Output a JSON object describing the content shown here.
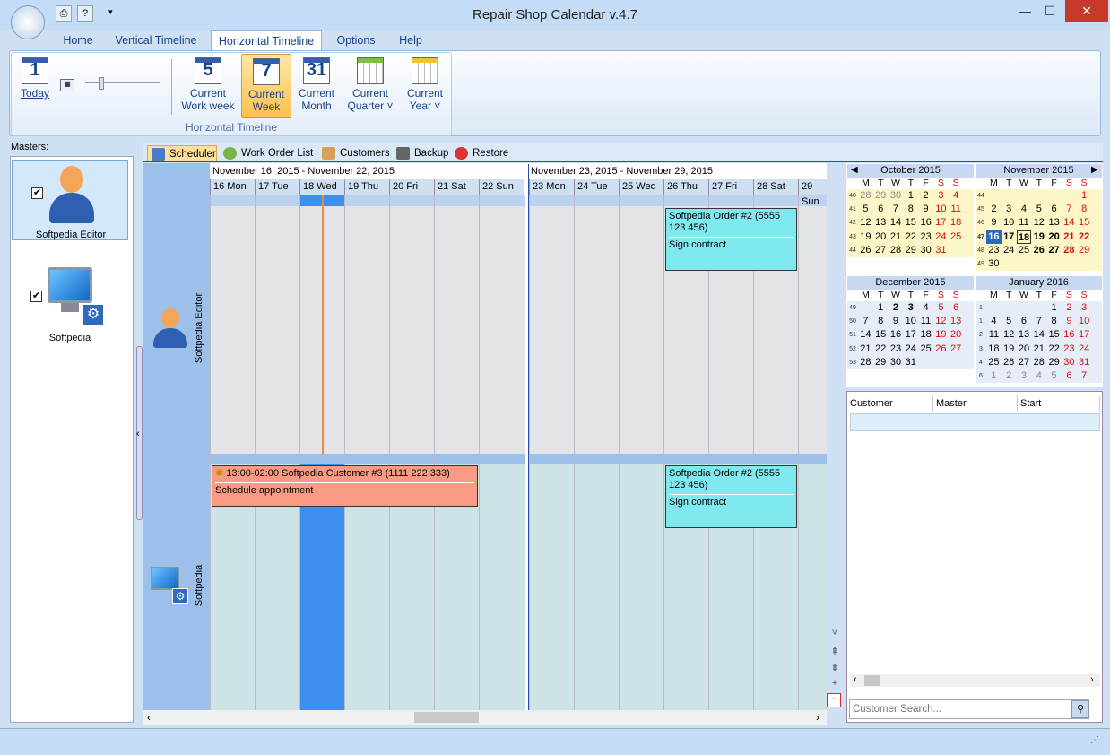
{
  "window": {
    "title": "Repair Shop Calendar v.4.7",
    "minimize": "—",
    "maximize": "☐",
    "close": "✕"
  },
  "ribbon": {
    "tabs": [
      "Home",
      "Vertical Timeline",
      "Horizontal Timeline",
      "Options",
      "Help"
    ],
    "active_tab": "Horizontal Timeline",
    "group_label": "Horizontal Timeline",
    "buttons": {
      "today": {
        "icon": "1",
        "label": "Today"
      },
      "work_week": {
        "icon": "5",
        "line1": "Current",
        "line2": "Work week"
      },
      "week": {
        "icon": "7",
        "line1": "Current",
        "line2": "Week"
      },
      "month": {
        "icon": "31",
        "line1": "Current",
        "line2": "Month"
      },
      "quarter": {
        "line1": "Current",
        "line2": "Quarter ˅"
      },
      "year": {
        "line1": "Current",
        "line2": "Year ˅"
      }
    }
  },
  "masters": {
    "label": "Masters:",
    "items": [
      {
        "name": "Softpedia Editor",
        "checked": "✔"
      },
      {
        "name": "Softpedia",
        "checked": "✔"
      }
    ]
  },
  "subtabs": [
    "Scheduler",
    "Work Order List",
    "Customers",
    "Backup",
    "Restore"
  ],
  "timeline": {
    "weeks": [
      "November 16, 2015 - November 22, 2015",
      "November 23, 2015 - November 29, 2015"
    ],
    "days": [
      "16 Mon",
      "17 Tue",
      "18 Wed",
      "19 Thu",
      "20 Fri",
      "21 Sat",
      "22 Sun",
      "23 Mon",
      "24 Tue",
      "25 Wed",
      "26 Thu",
      "27 Fri",
      "28 Sat",
      "29 Sun"
    ],
    "resources": [
      "Softpedia Editor",
      "Softpedia"
    ],
    "appointments": [
      {
        "title": "Softpedia Order #2 (5555 123 456)",
        "body": "Sign contract"
      },
      {
        "title": "13:00-02:00 Softpedia Customer #3 (1111 222 333)",
        "body": "Schedule appointment"
      },
      {
        "title": "Softpedia Order #2 (5555 123 456)",
        "body": "Sign contract"
      }
    ]
  },
  "calendars": [
    {
      "title": "October 2015",
      "dow": [
        "M",
        "T",
        "W",
        "T",
        "F",
        "S",
        "S"
      ],
      "weeks": [
        [
          "40",
          "28",
          "29",
          "30",
          "1",
          "2",
          "3",
          "4"
        ],
        [
          "41",
          "5",
          "6",
          "7",
          "8",
          "9",
          "10",
          "11"
        ],
        [
          "42",
          "12",
          "13",
          "14",
          "15",
          "16",
          "17",
          "18"
        ],
        [
          "43",
          "19",
          "20",
          "21",
          "22",
          "23",
          "24",
          "25"
        ],
        [
          "44",
          "26",
          "27",
          "28",
          "29",
          "30",
          "31",
          ""
        ]
      ]
    },
    {
      "title": "November 2015",
      "dow": [
        "M",
        "T",
        "W",
        "T",
        "F",
        "S",
        "S"
      ],
      "weeks": [
        [
          "44",
          "",
          "",
          "",
          "",
          "",
          "",
          "1"
        ],
        [
          "45",
          "2",
          "3",
          "4",
          "5",
          "6",
          "7",
          "8"
        ],
        [
          "46",
          "9",
          "10",
          "11",
          "12",
          "13",
          "14",
          "15"
        ],
        [
          "47",
          "16",
          "17",
          "18",
          "19",
          "20",
          "21",
          "22"
        ],
        [
          "48",
          "23",
          "24",
          "25",
          "26",
          "27",
          "28",
          "29"
        ],
        [
          "49",
          "30",
          "",
          "",
          "",
          "",
          "",
          ""
        ]
      ]
    },
    {
      "title": "December 2015",
      "dow": [
        "M",
        "T",
        "W",
        "T",
        "F",
        "S",
        "S"
      ],
      "weeks": [
        [
          "49",
          "",
          "1",
          "2",
          "3",
          "4",
          "5",
          "6"
        ],
        [
          "50",
          "7",
          "8",
          "9",
          "10",
          "11",
          "12",
          "13"
        ],
        [
          "51",
          "14",
          "15",
          "16",
          "17",
          "18",
          "19",
          "20"
        ],
        [
          "52",
          "21",
          "22",
          "23",
          "24",
          "25",
          "26",
          "27"
        ],
        [
          "53",
          "28",
          "29",
          "30",
          "31",
          "",
          "",
          ""
        ]
      ]
    },
    {
      "title": "January 2016",
      "dow": [
        "M",
        "T",
        "W",
        "T",
        "F",
        "S",
        "S"
      ],
      "weeks": [
        [
          "1",
          "",
          "",
          "",
          "",
          "1",
          "2",
          "3"
        ],
        [
          "1",
          "4",
          "5",
          "6",
          "7",
          "8",
          "9",
          "10"
        ],
        [
          "2",
          "11",
          "12",
          "13",
          "14",
          "15",
          "16",
          "17"
        ],
        [
          "3",
          "18",
          "19",
          "20",
          "21",
          "22",
          "23",
          "24"
        ],
        [
          "4",
          "25",
          "26",
          "27",
          "28",
          "29",
          "30",
          "31"
        ],
        [
          "6",
          "1",
          "2",
          "3",
          "4",
          "5",
          "6",
          "7"
        ]
      ]
    }
  ],
  "order_list": {
    "columns": [
      "Customer",
      "Master",
      "Start"
    ],
    "search_placeholder": "Customer Search..."
  }
}
